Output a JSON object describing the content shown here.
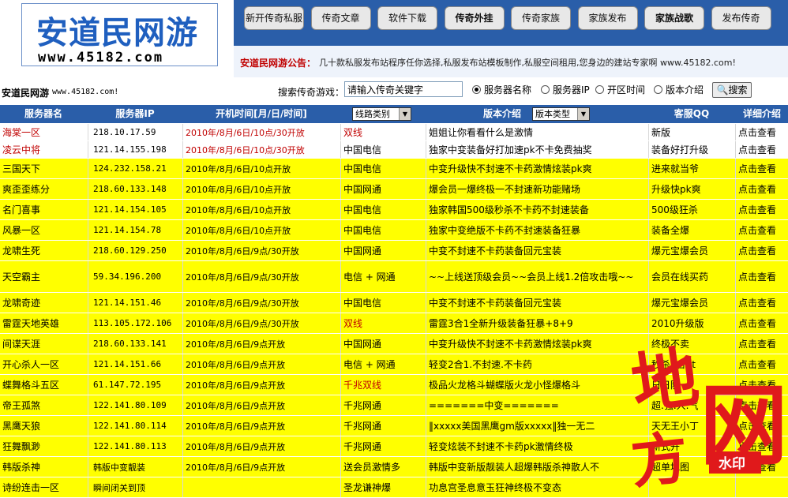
{
  "logo": {
    "title": "安道民网游",
    "url": "www.45182.com"
  },
  "nav": [
    {
      "label": "新开传奇私服",
      "bold": false
    },
    {
      "label": "传奇文章",
      "bold": false
    },
    {
      "label": "软件下载",
      "bold": false
    },
    {
      "label": "传奇外挂",
      "bold": true
    },
    {
      "label": "传奇家族",
      "bold": false
    },
    {
      "label": "家族发布",
      "bold": false
    },
    {
      "label": "家族战歌",
      "bold": true
    },
    {
      "label": "发布传奇",
      "bold": false
    }
  ],
  "notice": {
    "label": "安道民网游公告：",
    "text": "几十款私服发布站程序任你选择,私服发布站模板制作,私服空间租用,您身边的建站专家啊 www.45182.com!"
  },
  "search": {
    "site_name": "安道民网游",
    "site_url": "www.45182.com!",
    "label": "搜索传奇游戏：",
    "input_value": "请输入传奇关键字",
    "options": [
      {
        "label": "服务器名称",
        "checked": true
      },
      {
        "label": "服务器IP",
        "checked": false
      },
      {
        "label": "开区时间",
        "checked": false
      },
      {
        "label": "版本介绍",
        "checked": false
      }
    ],
    "button": "搜索"
  },
  "table": {
    "headers": {
      "name": "服务器名",
      "ip": "服务器IP",
      "time": "开机时间[月/日/时间]",
      "line_select": "线路类别",
      "version": "版本介绍",
      "version_select": "版本类型",
      "qq": "客服QQ",
      "detail": "详细介绍"
    },
    "rows": [
      {
        "name": "海棠一区",
        "ip": "218.10.17.59",
        "time": "2010年/8月/6日/10点/30开放",
        "line": "双线",
        "version": "姐姐让你看看什么是激情",
        "qq": "新版",
        "detail": "点击查看",
        "style": "red"
      },
      {
        "name": "凌云中将",
        "ip": "121.14.155.198",
        "time": "2010年/8月/6日/10点/30开放",
        "line": "中国电信",
        "version": "独家中变装备好打加速pk不卡免费抽奖",
        "qq": "装备好打升级",
        "detail": "点击查看",
        "style": "red"
      },
      {
        "name": "三国天下",
        "ip": "124.232.158.21",
        "time": "2010年/8月/6日/10点开放",
        "line": "中国电信",
        "version": "中变升级快不封速不卡药激情炫装pk爽",
        "qq": "进来就当爷",
        "detail": "点击查看",
        "style": "yellow"
      },
      {
        "name": "爽歪歪练分",
        "ip": "218.60.133.148",
        "time": "2010年/8月/6日/10点开放",
        "line": "中国网通",
        "version": "爆会员一爆终极一不封速新功能赌场",
        "qq": "升级快pk爽",
        "detail": "点击查看",
        "style": "yellow"
      },
      {
        "name": "名门喜事",
        "ip": "121.14.154.105",
        "time": "2010年/8月/6日/10点开放",
        "line": "中国电信",
        "version": "独家韩国500级秒杀不卡药不封速装备",
        "qq": "500级狂杀",
        "detail": "点击查看",
        "style": "yellow"
      },
      {
        "name": "风暴一区",
        "ip": "121.14.154.78",
        "time": "2010年/8月/6日/10点开放",
        "line": "中国电信",
        "version": "独家中变绝版不卡药不封速装备狂暴",
        "qq": "装备全爆",
        "detail": "点击查看",
        "style": "yellow"
      },
      {
        "name": "龙啸生死",
        "ip": "218.60.129.250",
        "time": "2010年/8月/6日/9点/30开放",
        "line": "中国网通",
        "version": "中变不封速不卡药装备回元宝装",
        "qq": "爆元宝爆会员",
        "detail": "点击查看",
        "style": "yellow"
      },
      {
        "name": "天空霸主",
        "ip": "59.34.196.200",
        "time": "2010年/8月/6日/9点/30开放",
        "line": "电信 + 网通",
        "version": "~~上线送顶级会员~~会员上线1.2倍攻击哦~~",
        "qq": "会员在线买药",
        "detail": "点击查看",
        "style": "yellow",
        "tall": true
      },
      {
        "name": "龙啸奇迹",
        "ip": "121.14.151.46",
        "time": "2010年/8月/6日/9点/30开放",
        "line": "中国电信",
        "version": "中变不封速不卡药装备回元宝装",
        "qq": "爆元宝爆会员",
        "detail": "点击查看",
        "style": "yellow"
      },
      {
        "name": "雷霆天地英雄",
        "ip": "113.105.172.106",
        "time": "2010年/8月/6日/9点/30开放",
        "line": "双线",
        "version": "雷霆3合1全新升级装备狂暴+8+9",
        "qq": "2010升级版",
        "detail": "点击查看",
        "style": "yellow",
        "linered": true
      },
      {
        "name": "间谍天涯",
        "ip": "218.60.133.141",
        "time": "2010年/8月/6日/9点开放",
        "line": "中国网通",
        "version": "中变升级快不封速不卡药激情炫装pk爽",
        "qq": "终极不卖",
        "detail": "点击查看",
        "style": "yellow"
      },
      {
        "name": "开心杀人一区",
        "ip": "121.14.151.66",
        "time": "2010年/8月/6日/9点开放",
        "line": "电信 + 网通",
        "version": "轻变2合1.不封速.不卡药",
        "qq": "秒杀3合3t",
        "detail": "点击查看",
        "style": "yellow"
      },
      {
        "name": "蝶舞格斗五区",
        "ip": "61.147.72.195",
        "time": "2010年/8月/6日/9点开放",
        "line": "千兆双线",
        "version": "极品火龙格斗蝴蝶版火龙小怪爆格斗",
        "qq": "日日防",
        "detail": "点击查看",
        "style": "yellow",
        "linered": true
      },
      {
        "name": "帝王孤煞",
        "ip": "122.141.80.109",
        "time": "2010年/8月/6日/9点开放",
        "line": "千兆网通",
        "version": "=======中变=======",
        "qq": "超.强.人.气",
        "detail": "点击查看",
        "style": "yellow"
      },
      {
        "name": "黑鹰天狼",
        "ip": "122.141.80.114",
        "time": "2010年/8月/6日/9点开放",
        "line": "千兆网通",
        "version": "‖xxxxx美国黑鹰gm版xxxxx‖独一无二",
        "qq": "天无王小丁",
        "detail": "点击查看",
        "style": "yellow"
      },
      {
        "name": "狂舞飘渺",
        "ip": "122.141.80.113",
        "time": "2010年/8月/6日/9点开放",
        "line": "千兆网通",
        "version": "轻变炫装不封速不卡药pk激情终极",
        "qq": "新式开",
        "detail": "点击查看",
        "style": "yellow"
      },
      {
        "name": "韩版杀神",
        "ip": "韩版中变靓装",
        "time": "2010年/8月/6日/9点开放",
        "line": "送会员激情多",
        "version": "韩版中变新版靓装人超爆韩版杀神散人不",
        "qq": "超单地图",
        "detail": "点击查看",
        "style": "yellow"
      },
      {
        "name": "诗纷连击一区",
        "ip": "瞬间闭关到顶",
        "time": "",
        "line": "圣龙谦神爆",
        "version": "功息宫圣息意玉狂神终极不变态",
        "qq": "",
        "detail": "",
        "style": "yellow"
      }
    ]
  },
  "watermark": {
    "chars": [
      "地",
      "方",
      "网"
    ],
    "badge": "水印"
  },
  "colors": {
    "nav_bg": "#2a5ea9",
    "row_yellow": "#ffff00",
    "row_white": "#ffffff",
    "red_text": "#c00000",
    "watermark_red": "#e0191b"
  }
}
